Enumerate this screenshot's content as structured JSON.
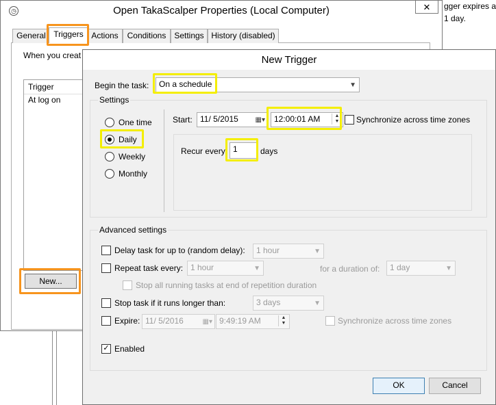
{
  "background_window": {
    "line1": "gger expires at",
    "line2": "1 day."
  },
  "properties_window": {
    "title": "Open TakaScalper Properties (Local Computer)",
    "close_label": "✕",
    "tabs": [
      "General",
      "Triggers",
      "Actions",
      "Conditions",
      "Settings",
      "History (disabled)"
    ],
    "when_text": "When you creat",
    "list_header": "Trigger",
    "list_row": "At log on",
    "new_button": "New..."
  },
  "new_trigger": {
    "title": "New Trigger",
    "begin_label": "Begin the task:",
    "begin_value": "On a schedule",
    "settings_label": "Settings",
    "schedule_options": [
      "One time",
      "Daily",
      "Weekly",
      "Monthly"
    ],
    "selected_option": "Daily",
    "start_label": "Start:",
    "start_date": "11/  5/2015",
    "start_time": "12:00:01 AM",
    "sync_label": "Synchronize across time zones",
    "recur_label": "Recur every:",
    "recur_value": "1",
    "recur_unit": "days",
    "advanced_label": "Advanced settings",
    "delay_label": "Delay task for up to (random delay):",
    "delay_value": "1 hour",
    "repeat_label": "Repeat task every:",
    "repeat_value": "1 hour",
    "duration_label": "for a duration of:",
    "duration_value": "1 day",
    "stop_running_label": "Stop all running tasks at end of repetition duration",
    "stop_longer_label": "Stop task if it runs longer than:",
    "stop_longer_value": "3 days",
    "expire_label": "Expire:",
    "expire_date": "11/  5/2016",
    "expire_time": "9:49:19 AM",
    "expire_sync_label": "Synchronize across time zones",
    "enabled_label": "Enabled",
    "ok_label": "OK",
    "cancel_label": "Cancel"
  },
  "colors": {
    "orange_highlight": "#f7941d",
    "yellow_highlight": "#f4ee00"
  }
}
